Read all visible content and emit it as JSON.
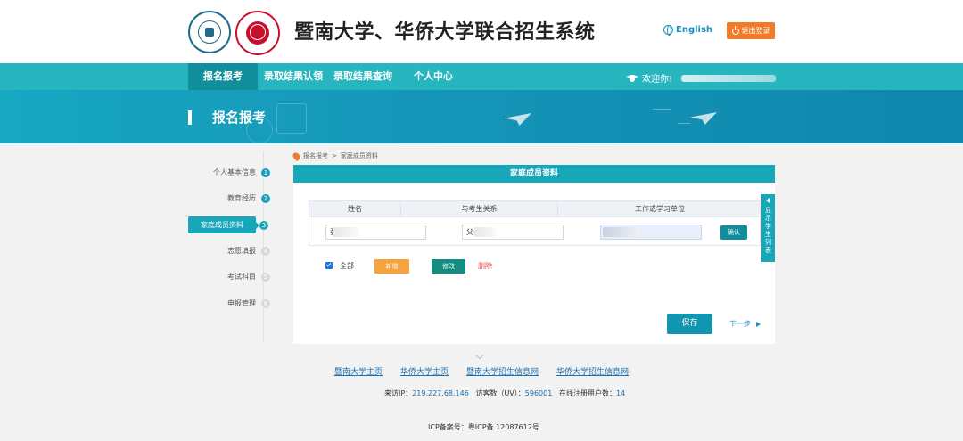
{
  "header": {
    "site_title": "暨南大学、华侨大学联合招生系统",
    "lang_label": "English",
    "logout_label": "退出登录"
  },
  "nav": {
    "items": [
      {
        "label": "报名报考",
        "active": true
      },
      {
        "label": "录取结果认领"
      },
      {
        "label": "录取结果查询"
      },
      {
        "label": "个人中心"
      }
    ],
    "welcome": "欢迎你!"
  },
  "banner": {
    "title": "报名报考"
  },
  "sidebar": {
    "steps": [
      {
        "label": "个人基本信息",
        "num": "1",
        "state": "done"
      },
      {
        "label": "教育经历",
        "num": "2",
        "state": "done"
      },
      {
        "label": "家庭成员资料",
        "num": "3",
        "state": "active"
      },
      {
        "label": "志愿填报",
        "num": "4",
        "state": "todo"
      },
      {
        "label": "考试科目",
        "num": "5",
        "state": "todo"
      },
      {
        "label": "申报管理",
        "num": "6",
        "state": "todo"
      }
    ]
  },
  "breadcrumb": {
    "root": "报名报考",
    "sep": ">",
    "current": "家庭成员资料"
  },
  "panel": {
    "title": "家庭成员资料",
    "columns": [
      "姓名",
      "与考生关系",
      "工作或学习单位"
    ],
    "row": {
      "name": "张",
      "relation": "父亲",
      "work": ""
    },
    "confirm_label": "确认",
    "select_all_label": "全部",
    "add_label": "新增",
    "edit_label": "修改",
    "delete_label": "删除",
    "save_label": "保存",
    "next_label": "下一步",
    "side_tab_label": "显示学生列表"
  },
  "footer": {
    "links": [
      "暨南大学主页",
      "华侨大学主页",
      "暨南大学招生信息网",
      "华侨大学招生信息网"
    ],
    "ip_label": "来访IP：",
    "ip_value": "219.227.68.146",
    "uv_label": "访客数（UV）：",
    "uv_value": "596001",
    "online_label": "在线注册用户数：",
    "online_value": "14",
    "icp": "ICP备案号：粤ICP备 12087612号"
  },
  "colors": {
    "accent": "#27b5bf",
    "accent_dark": "#108e9b",
    "orange": "#f07b2a",
    "banner": "#1597b9"
  }
}
